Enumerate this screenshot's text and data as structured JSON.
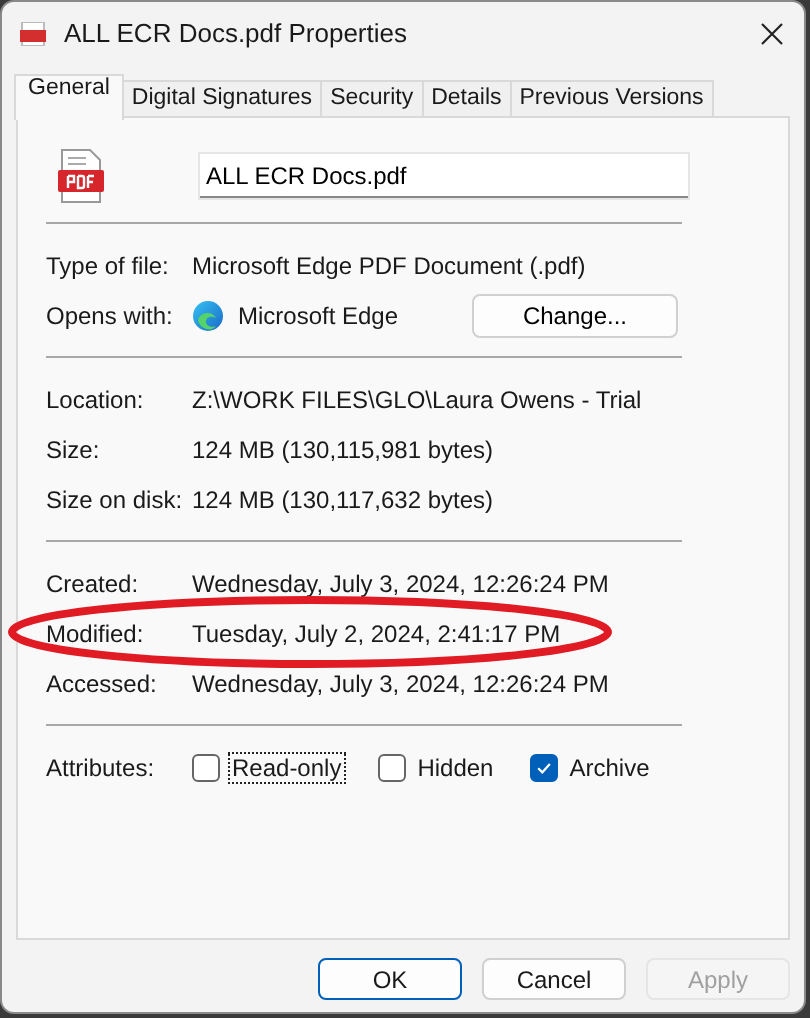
{
  "window": {
    "title": "ALL ECR Docs.pdf Properties"
  },
  "tabs": [
    {
      "label": "General",
      "selected": true
    },
    {
      "label": "Digital Signatures",
      "selected": false
    },
    {
      "label": "Security",
      "selected": false
    },
    {
      "label": "Details",
      "selected": false
    },
    {
      "label": "Previous Versions",
      "selected": false
    }
  ],
  "file_name": {
    "value": "ALL ECR Docs.pdf"
  },
  "type_of_file": {
    "label": "Type of file:",
    "value": "Microsoft Edge PDF Document (.pdf)"
  },
  "opens_with": {
    "label": "Opens with:",
    "value": "Microsoft Edge",
    "button": "Change..."
  },
  "location_rows": [
    {
      "label": "Location:",
      "value": "Z:\\WORK FILES\\GLO\\Laura Owens - Trial"
    },
    {
      "label": "Size:",
      "value": "124 MB (130,115,981 bytes)"
    },
    {
      "label": "Size on disk:",
      "value": "124 MB (130,117,632 bytes)"
    }
  ],
  "date_rows": [
    {
      "label": "Created:",
      "value": "Wednesday, July 3, 2024, 12:26:24 PM",
      "circled": false
    },
    {
      "label": "Modified:",
      "value": "Tuesday, July 2, 2024, 2:41:17 PM",
      "circled": true
    },
    {
      "label": "Accessed:",
      "value": "Wednesday, July 3, 2024, 12:26:24 PM",
      "circled": false
    }
  ],
  "attributes": {
    "label": "Attributes:",
    "items": [
      {
        "label": "Read-only",
        "checked": false,
        "focused": true
      },
      {
        "label": "Hidden",
        "checked": false,
        "focused": false
      },
      {
        "label": "Archive",
        "checked": true,
        "focused": false
      }
    ]
  },
  "buttons": [
    {
      "label": "OK",
      "default": true,
      "disabled": false
    },
    {
      "label": "Cancel",
      "default": false,
      "disabled": false
    },
    {
      "label": "Apply",
      "default": false,
      "disabled": true
    }
  ]
}
